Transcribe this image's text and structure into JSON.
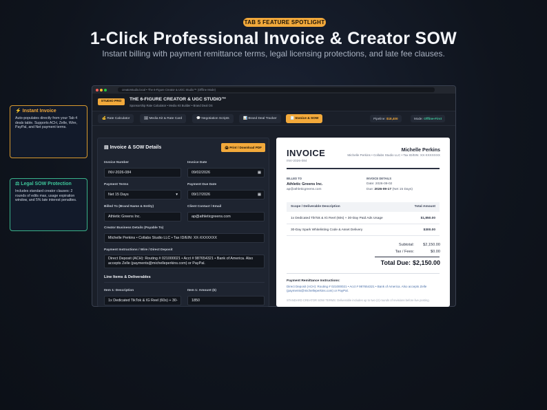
{
  "badge": "TAB 5 FEATURE SPOTLIGHT",
  "hero": {
    "title": "1-Click Professional Invoice & Creator SOW",
    "subtitle": "Instant billing with payment remittance terms, legal licensing protections, and late fee clauses."
  },
  "callouts": [
    {
      "icon": "⚡",
      "title": "Instant Invoice",
      "body": "Auto-populates directly from your Tab 4 deals table. Supports ACH, Zelle, Wire, PayPal, and Net payment terms."
    },
    {
      "icon": "⚖",
      "title": "Legal SOW Protection",
      "body": "Includes standard creator clauses: 2 rounds of edits max, usage expiration window, and 5% late interest penalties."
    }
  ],
  "window": {
    "url": "creatorstudio.local • The 6-Figure Creator & UGC Studio™ (Offline Mode)",
    "logo": "STUDIO PRO",
    "app_title": "THE 6-FIGURE CREATOR & UGC STUDIO™",
    "app_sub": "Sponsorship Rate Calculator • Media Kit Builder • Brand Deal OS",
    "tabs": [
      {
        "icon": "💰",
        "label": "Rate Calculator"
      },
      {
        "icon": "🖼",
        "label": "Media Kit & Rate Card"
      },
      {
        "icon": "💬",
        "label": "Negotiation Scripts"
      },
      {
        "icon": "📊",
        "label": "Brand Deal Tracker"
      },
      {
        "icon": "🧾",
        "label": "Invoice & SOW"
      }
    ],
    "pipeline_label": "Pipeline:",
    "pipeline_value": "$18,400",
    "mode_label": "Mode:",
    "mode_value": "Offline-First"
  },
  "form": {
    "title": "Invoice & SOW Details",
    "download": "🖨 Print / Download PDF",
    "invoice_number_label": "Invoice Number",
    "invoice_number": "INV-2026-084",
    "invoice_date_label": "Invoice Date",
    "invoice_date": "09/02/2026",
    "payment_terms_label": "Payment Terms",
    "payment_terms": "Net 15 Days",
    "due_date_label": "Payment Due Date",
    "due_date": "09/17/2026",
    "billed_to_label": "Billed To (Brand Name & Entity)",
    "billed_to": "Athletic Greens Inc.",
    "client_contact_label": "Client Contact / Email",
    "client_contact": "ap@athleticgreens.com",
    "creator_label": "Creator Business Details (Payable To)",
    "creator": "Michelle Perkins • Collabs Studio LLC • Tax ID/EIN: XX-XXXXXXX",
    "payment_instr_label": "Payment Instructions / Wire / Direct Deposit",
    "payment_instr": "Direct Deposit (ACH): Routing # 021000021 • Acct # 987654321 • Bank of America. Also accepts Zelle (payments@michelleperkins.com) or PayPal.",
    "line_items_title": "Line Items & Deliverables",
    "item1_desc_label": "Item 1: Description",
    "item1_desc": "1x Dedicated TikTok & IG Reel (60s) + 30-",
    "item1_amount_label": "Item 1: Amount ($)",
    "item1_amount": "1850"
  },
  "invoice": {
    "heading": "INVOICE",
    "number": "INV-2026-084",
    "creator_name": "Michelle Perkins",
    "creator_biz": "Michelle Perkins • Collabs Studio LLC • Tax ID/EIN: XX-XXXXXXX",
    "billed_to_label": "BILLED TO",
    "billed_to": "Athletic Greens Inc.",
    "billed_email": "ap@athleticgreens.com",
    "details_label": "INVOICE DETAILS",
    "date_line": "Date: 2026-09-02",
    "due_prefix": "Due:",
    "due_date": "2026-09-17",
    "due_suffix": "(Net 15 Days)",
    "col_scope": "Scope / Deliverable Description",
    "col_total": "Total Amount",
    "items": [
      {
        "desc": "1x Dedicated TikTok & IG Reel (60s) + 30-Day Paid Ads Usage",
        "amount": "$1,850.00"
      },
      {
        "desc": "30-Day Spark Whitelisting Code & Asset Delivery",
        "amount": "$300.00"
      }
    ],
    "subtotal_label": "Subtotal:",
    "subtotal": "$2,150.00",
    "tax_label": "Tax / Fees:",
    "tax": "$0.00",
    "total_label": "Total Due:",
    "total": "$2,150.00",
    "remit_title": "Payment Remittance Instructions:",
    "remit_body": "Direct Deposit (ACH): Routing # 021000021 • Acct # 987654321 • Bank of America. Also accepts Zelle (payments@michelleperkins.com) or PayPal.",
    "sow_body": "STANDARD CREATOR SOW TERMS: Deliverable includes up to two (2) rounds of revisions before live posting."
  },
  "colors": {
    "accent": "#f2a93b",
    "success": "#3fc79b",
    "bg": "#0f141d"
  }
}
